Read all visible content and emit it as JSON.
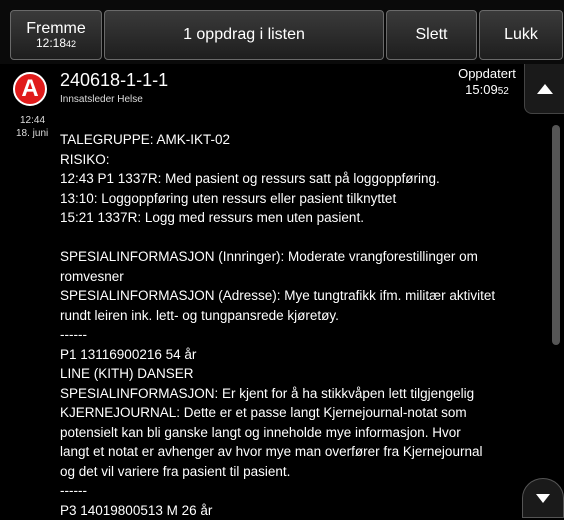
{
  "toolbar": {
    "fremme_label": "Fremme",
    "fremme_time_main": "12:18",
    "fremme_time_sec": "42",
    "count_label": "1 oppdrag i listen",
    "slett_label": "Slett",
    "lukk_label": "Lukk"
  },
  "incident": {
    "badge": "A",
    "id": "240618-1-1-1",
    "role": "Innsatsleder Helse",
    "time": "12:44",
    "date": "18. juni",
    "updated_label": "Oppdatert",
    "updated_time_main": "15:09",
    "updated_time_sec": "52"
  },
  "lines": [
    "TALEGRUPPE: AMK-IKT-02",
    "RISIKO:",
    "12:43 P1 1337R: Med pasient og ressurs satt på loggoppføring.",
    "13:10: Loggoppføring uten ressurs eller pasient tilknyttet",
    "15:21 1337R: Logg med ressurs men uten pasient.",
    "",
    "SPESIALINFORMASJON (Innringer): Moderate vrangforestillinger om",
    "romvesner",
    "SPESIALINFORMASJON (Adresse): Mye tungtrafikk ifm. militær aktivitet",
    "rundt leiren ink. lett- og tungpansrede kjøretøy.",
    "------",
    "P1 13116900216  54 år",
    "LINE (KITH) DANSER",
    "SPESIALINFORMASJON: Er kjent for å ha stikkvåpen lett tilgjengelig",
    "KJERNEJOURNAL: Dette er et passe langt Kjernejournal-notat som",
    "potensielt kan bli ganske langt og inneholde mye informasjon. Hvor",
    "langt et notat er avhenger av hvor mye man overfører fra Kjernejournal",
    "og det vil variere fra pasient til pasient.",
    "------",
    "P3 14019800513 M 26 år"
  ]
}
